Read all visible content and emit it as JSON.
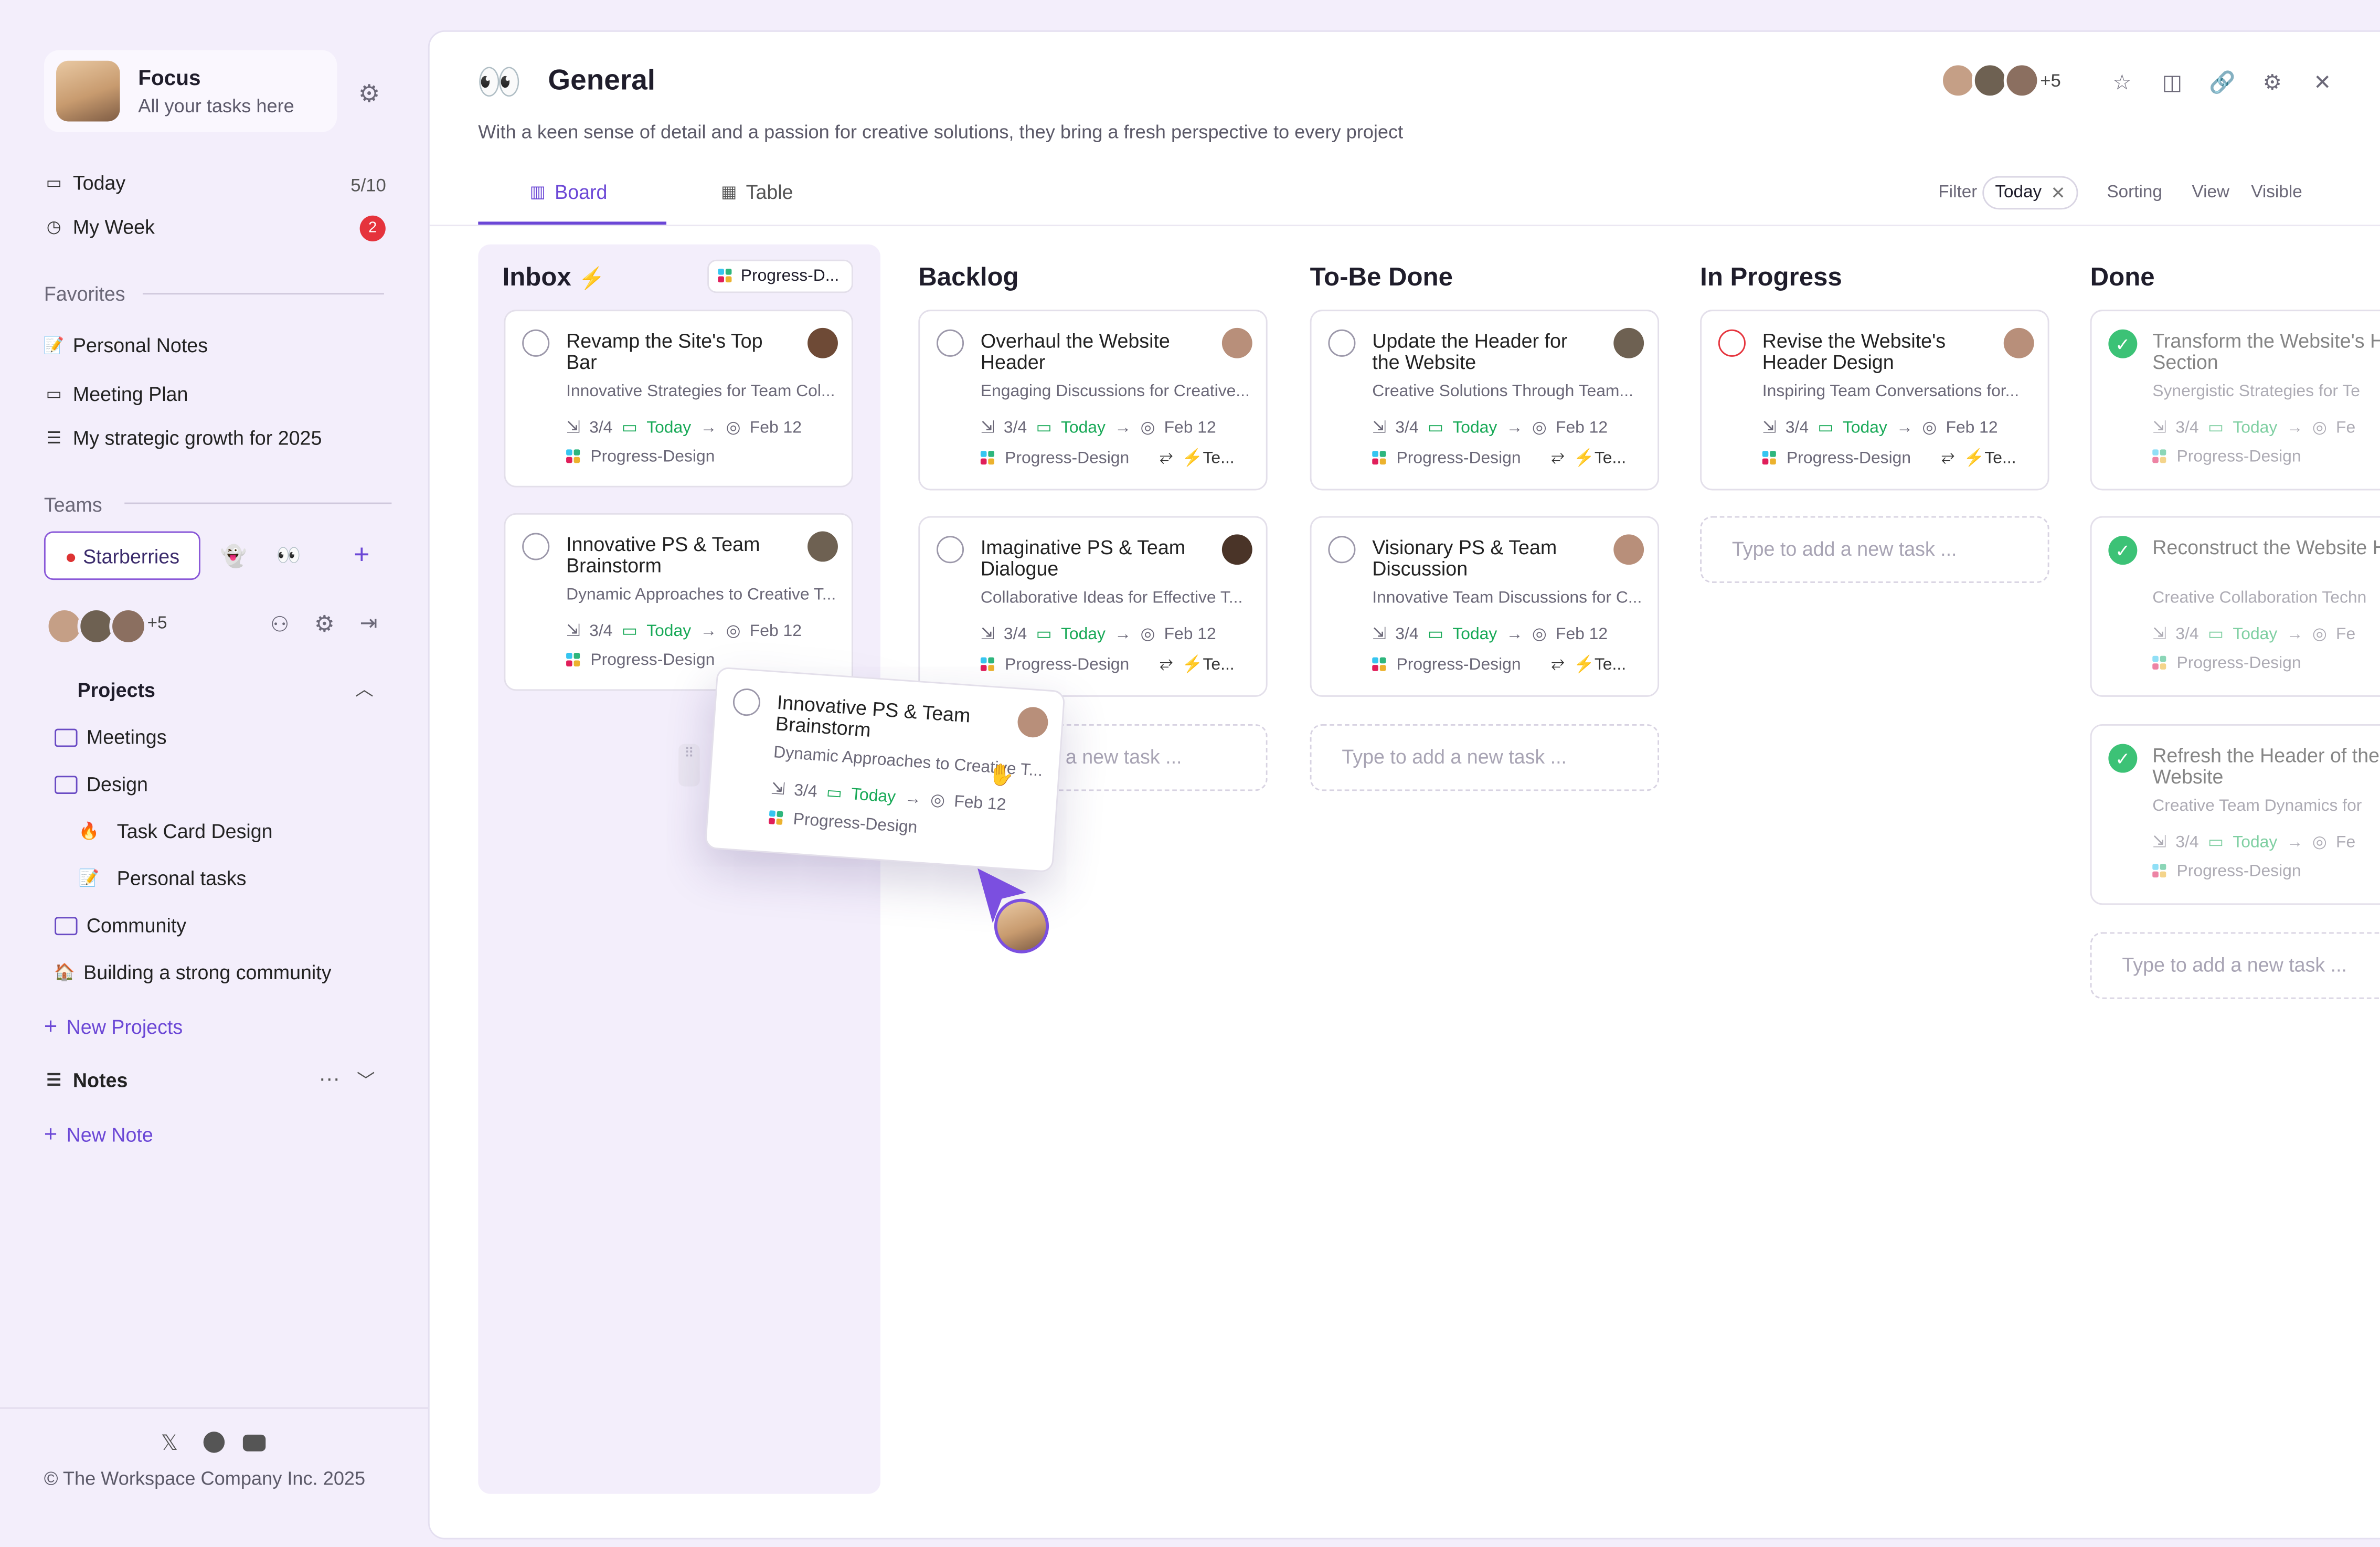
{
  "profile": {
    "name": "Focus",
    "subtitle": "All your tasks here"
  },
  "nav": {
    "today": {
      "label": "Today",
      "count": "5/10"
    },
    "week": {
      "label": "My Week",
      "badge": "2"
    }
  },
  "favorites": {
    "title": "Favorites",
    "items": [
      "Personal Notes",
      "Meeting Plan",
      "My strategic growth for 2025"
    ]
  },
  "teams": {
    "title": "Teams",
    "active": "Starberries",
    "more_members": "+5"
  },
  "projects": {
    "title": "Projects",
    "items": [
      "Meetings",
      "Design",
      "Task Card Design",
      "Personal tasks",
      "Community",
      "Building a strong community"
    ],
    "new_label": "New Projects"
  },
  "notes": {
    "title": "Notes",
    "new_label": "New Note"
  },
  "footer": {
    "copyright": "© The Workspace Company Inc. 2025"
  },
  "header": {
    "title": "General",
    "description": "With a keen sense of detail and a passion for creative solutions, they bring a fresh perspective to every project",
    "members_more": "+5",
    "tabs": [
      "Board",
      "Table"
    ],
    "filter_label": "Filter",
    "filter_value": "Today",
    "sorting": "Sorting",
    "view": "View",
    "visible": "Visible"
  },
  "board": {
    "add_placeholder": "Type to add a new task ...",
    "inbox": {
      "title": "Inbox",
      "tag": "Progress-D...",
      "cards": [
        {
          "title": "Revamp the Site's Top Bar",
          "sub": "Innovative Strategies for Team Col...",
          "progress": "3/4",
          "due": "Today",
          "date": "Feb 12",
          "tag": "Progress-Design"
        },
        {
          "title": "Innovative PS & Team Brainstorm",
          "sub": "Dynamic Approaches to Creative T...",
          "progress": "3/4",
          "due": "Today",
          "date": "Feb 12",
          "tag": "Progress-Design"
        }
      ]
    },
    "backlog": {
      "title": "Backlog",
      "cards": [
        {
          "title": "Overhaul the Website Header",
          "sub": "Engaging Discussions for Creative...",
          "progress": "3/4",
          "due": "Today",
          "date": "Feb 12",
          "tag": "Progress-Design",
          "extra": "⚡Te..."
        },
        {
          "title": "Imaginative PS & Team Dialogue",
          "sub": "Collaborative Ideas for Effective T...",
          "progress": "3/4",
          "due": "Today",
          "date": "Feb 12",
          "tag": "Progress-Design",
          "extra": "⚡Te..."
        }
      ],
      "add_partial": "a new task ..."
    },
    "tobedone": {
      "title": "To-Be Done",
      "cards": [
        {
          "title": "Update the Header for the Website",
          "sub": "Creative Solutions Through Team...",
          "progress": "3/4",
          "due": "Today",
          "date": "Feb 12",
          "tag": "Progress-Design",
          "extra": "⚡Te..."
        },
        {
          "title": "Visionary PS & Team Discussion",
          "sub": "Innovative Team Discussions for C...",
          "progress": "3/4",
          "due": "Today",
          "date": "Feb 12",
          "tag": "Progress-Design",
          "extra": "⚡Te..."
        }
      ]
    },
    "inprogress": {
      "title": "In Progress",
      "cards": [
        {
          "title": "Revise the Website's Header Design",
          "sub": "Inspiring Team Conversations for...",
          "progress": "3/4",
          "due": "Today",
          "date": "Feb 12",
          "tag": "Progress-Design",
          "extra": "⚡Te..."
        }
      ]
    },
    "done": {
      "title": "Done",
      "cards": [
        {
          "title": "Transform the Website's Header Section",
          "sub": "Synergistic Strategies for Te",
          "progress": "3/4",
          "due": "Today",
          "date": "Fe",
          "tag": "Progress-Design"
        },
        {
          "title": "Reconstruct the Website Header",
          "sub": "Creative Collaboration Techn",
          "progress": "3/4",
          "due": "Today",
          "date": "Fe",
          "tag": "Progress-Design"
        },
        {
          "title": "Refresh the Header of the Website",
          "sub": "Creative Team Dynamics for",
          "progress": "3/4",
          "due": "Today",
          "date": "Fe",
          "tag": "Progress-Design"
        }
      ]
    },
    "dragging": {
      "title": "Innovative PS & Team Brainstorm",
      "sub": "Dynamic Approaches to Creative T...",
      "progress": "3/4",
      "due": "Today",
      "date": "Feb 12",
      "tag": "Progress-Design"
    }
  },
  "colors": {
    "accent": "#6b47d6",
    "bg": "#f3eefb",
    "green": "#18a957",
    "red": "#e5333c"
  }
}
